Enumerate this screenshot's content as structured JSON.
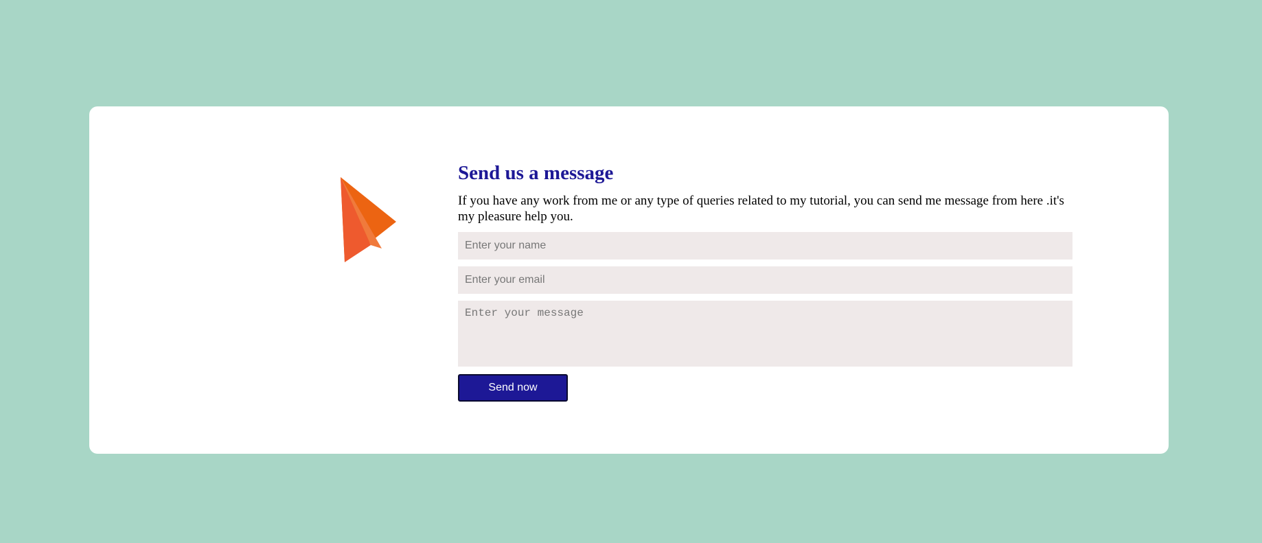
{
  "colors": {
    "page_background": "#a8d6c6",
    "card_background": "#ffffff",
    "heading": "#1d1896",
    "button": "#1d1896",
    "field_background": "#efe9e9",
    "logo_primary": "#ec6412",
    "logo_secondary": "#f07a3c",
    "logo_shadow": "#e8552f"
  },
  "logo": {
    "icon": "paper-plane-icon"
  },
  "contact": {
    "heading": "Send us a message",
    "description": "If you have any work from me or any type of queries related to my tutorial, you can send me message from here .it's my pleasure help you.",
    "name_placeholder": "Enter your name",
    "email_placeholder": "Enter your email",
    "message_placeholder": "Enter your message",
    "button_label": "Send now"
  }
}
